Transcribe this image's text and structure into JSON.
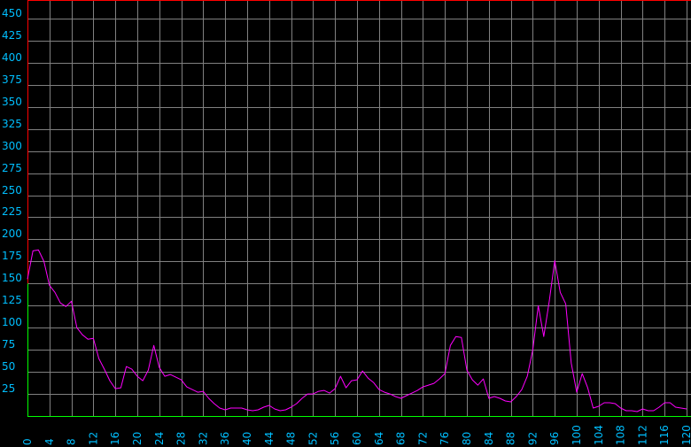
{
  "chart_data": {
    "type": "line",
    "title": "",
    "xlabel": "",
    "ylabel": "",
    "xlim": [
      0,
      120
    ],
    "ylim": [
      0,
      470
    ],
    "grid": true,
    "x_ticks": [
      0,
      4,
      8,
      12,
      16,
      20,
      24,
      28,
      32,
      36,
      40,
      44,
      48,
      52,
      56,
      60,
      64,
      68,
      72,
      76,
      80,
      84,
      88,
      92,
      96,
      100,
      104,
      108,
      112,
      116,
      120
    ],
    "y_ticks": [
      25,
      50,
      75,
      100,
      125,
      150,
      175,
      200,
      225,
      250,
      275,
      300,
      325,
      350,
      375,
      400,
      425,
      450
    ],
    "colors": {
      "background": "#000000",
      "grid": "#808080",
      "x_axis": "#00ff00",
      "y_axis_lower": "#00ff00",
      "y_axis_upper": "#ff0000",
      "top_border": "#ff0000",
      "tick_labels": "#00bfff",
      "series": "#ff00ff"
    },
    "y_axis_color_split": 150,
    "series": [
      {
        "x": [
          0,
          1,
          2,
          3,
          4,
          5,
          6,
          7,
          8,
          9,
          10,
          11,
          12,
          13,
          14,
          15,
          16,
          17,
          18,
          19,
          20,
          21,
          22,
          23,
          24,
          25,
          26,
          27,
          28,
          29,
          30,
          31,
          32,
          33,
          34,
          35,
          36,
          37,
          38,
          39,
          40,
          41,
          42,
          43,
          44,
          45,
          46,
          47,
          48,
          49,
          50,
          51,
          52,
          53,
          54,
          55,
          56,
          57,
          58,
          59,
          60,
          61,
          62,
          63,
          64,
          65,
          66,
          67,
          68,
          69,
          70,
          71,
          72,
          73,
          74,
          75,
          76,
          77,
          78,
          79,
          80,
          81,
          82,
          83,
          84,
          85,
          86,
          87,
          88,
          89,
          90,
          91,
          92,
          93,
          94,
          95,
          96,
          97,
          98,
          99,
          100,
          101,
          102,
          103,
          104,
          105,
          106,
          107,
          108,
          109,
          110,
          111,
          112,
          113,
          114,
          115,
          116,
          117,
          118,
          119,
          120
        ],
        "values": [
          155,
          187,
          188,
          175,
          148,
          140,
          128,
          124,
          130,
          100,
          92,
          87,
          88,
          65,
          53,
          40,
          31,
          32,
          56,
          53,
          45,
          40,
          52,
          80,
          55,
          45,
          47,
          44,
          41,
          33,
          30,
          27,
          28,
          20,
          14,
          9,
          7,
          9,
          9,
          9,
          7,
          6,
          7,
          10,
          12,
          8,
          6,
          7,
          10,
          14,
          20,
          25,
          25,
          28,
          29,
          26,
          31,
          45,
          32,
          40,
          41,
          51,
          43,
          38,
          30,
          27,
          25,
          22,
          20,
          23,
          26,
          29,
          33,
          35,
          37,
          42,
          48,
          80,
          90,
          89,
          52,
          41,
          35,
          42,
          20,
          22,
          20,
          17,
          16,
          22,
          30,
          45,
          75,
          125,
          90,
          130,
          176,
          140,
          127,
          60,
          27,
          48,
          32,
          9,
          11,
          15,
          15,
          14,
          9,
          6,
          6,
          5,
          8,
          6,
          6,
          10,
          15,
          15,
          10,
          9,
          8
        ]
      }
    ]
  }
}
